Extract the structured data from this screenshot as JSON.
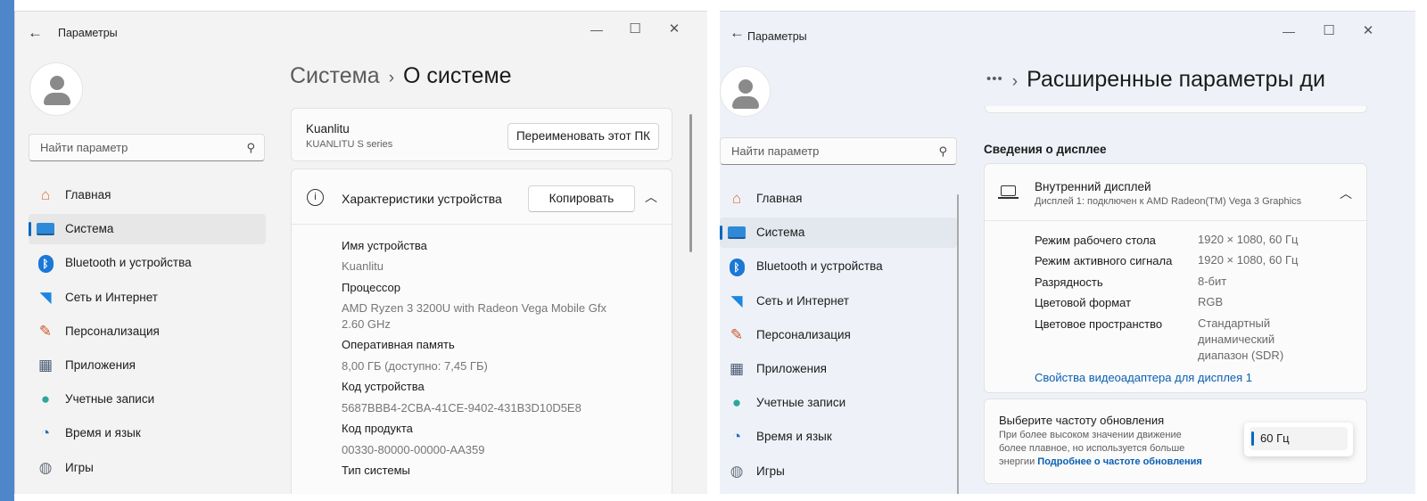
{
  "left": {
    "window_title": "Параметры",
    "search_placeholder": "Найти параметр",
    "nav": [
      {
        "label": "Главная",
        "icon": "home-icon"
      },
      {
        "label": "Система",
        "icon": "system-icon",
        "active": true
      },
      {
        "label": "Bluetooth и устройства",
        "icon": "bluetooth-icon"
      },
      {
        "label": "Сеть и Интернет",
        "icon": "wifi-icon"
      },
      {
        "label": "Персонализация",
        "icon": "brush-icon"
      },
      {
        "label": "Приложения",
        "icon": "apps-icon"
      },
      {
        "label": "Учетные записи",
        "icon": "account-icon"
      },
      {
        "label": "Время и язык",
        "icon": "clock-globe-icon"
      },
      {
        "label": "Игры",
        "icon": "gamepad-icon"
      }
    ],
    "breadcrumb": {
      "parent": "Система",
      "current": "О системе"
    },
    "device_card": {
      "name": "Kuanlitu",
      "model": "KUANLITU S series",
      "rename_button": "Переименовать этот ПК"
    },
    "specs_card": {
      "title": "Характеристики устройства",
      "copy_button": "Копировать",
      "items": [
        {
          "label": "Имя устройства",
          "value": "Kuanlitu"
        },
        {
          "label": "Процессор",
          "value": "AMD Ryzen 3 3200U with Radeon Vega Mobile Gfx",
          "value2": "2.60 GHz"
        },
        {
          "label": "Оперативная память",
          "value": "8,00 ГБ (доступно: 7,45 ГБ)"
        },
        {
          "label": "Код устройства",
          "value": "5687BBB4-2CBA-41CE-9402-431B3D10D5E8"
        },
        {
          "label": "Код продукта",
          "value": "00330-80000-00000-AA359"
        },
        {
          "label": "Тип системы",
          "value": ""
        }
      ]
    }
  },
  "right": {
    "window_title": "Параметры",
    "search_placeholder": "Найти параметр",
    "nav": [
      {
        "label": "Главная",
        "icon": "home-icon"
      },
      {
        "label": "Система",
        "icon": "system-icon",
        "active": true
      },
      {
        "label": "Bluetooth и устройства",
        "icon": "bluetooth-icon"
      },
      {
        "label": "Сеть и Интернет",
        "icon": "wifi-icon"
      },
      {
        "label": "Персонализация",
        "icon": "brush-icon"
      },
      {
        "label": "Приложения",
        "icon": "apps-icon"
      },
      {
        "label": "Учетные записи",
        "icon": "account-icon"
      },
      {
        "label": "Время и язык",
        "icon": "clock-globe-icon"
      },
      {
        "label": "Игры",
        "icon": "gamepad-icon"
      }
    ],
    "breadcrumb": {
      "ellipsis": "•••",
      "current": "Расширенные параметры ди"
    },
    "section_title": "Сведения о дисплее",
    "display_card": {
      "title": "Внутренний дисплей",
      "subtitle": "Дисплей 1: подключен к AMD Radeon(TM) Vega 3 Graphics",
      "rows": [
        {
          "label": "Режим рабочего стола",
          "value": "1920 × 1080, 60 Гц"
        },
        {
          "label": "Режим активного сигнала",
          "value": "1920 × 1080, 60 Гц"
        },
        {
          "label": "Разрядность",
          "value": "8-бит"
        },
        {
          "label": "Цветовой формат",
          "value": "RGB"
        },
        {
          "label": "Цветовое пространство",
          "value_lines": [
            "Стандартный",
            "динамический",
            "диапазон (SDR)"
          ]
        }
      ],
      "link": "Свойства видеоадаптера для дисплея 1"
    },
    "refresh_card": {
      "title": "Выберите частоту обновления",
      "desc_lines": [
        "При более высоком значении движение",
        "более плавное, но используется больше"
      ],
      "desc_last": "энергии",
      "more_link": "Подробнее о частоте обновления",
      "selected": "60 Гц"
    }
  },
  "colors": {
    "accent": "#0067c0",
    "link": "#0a5fb3"
  }
}
